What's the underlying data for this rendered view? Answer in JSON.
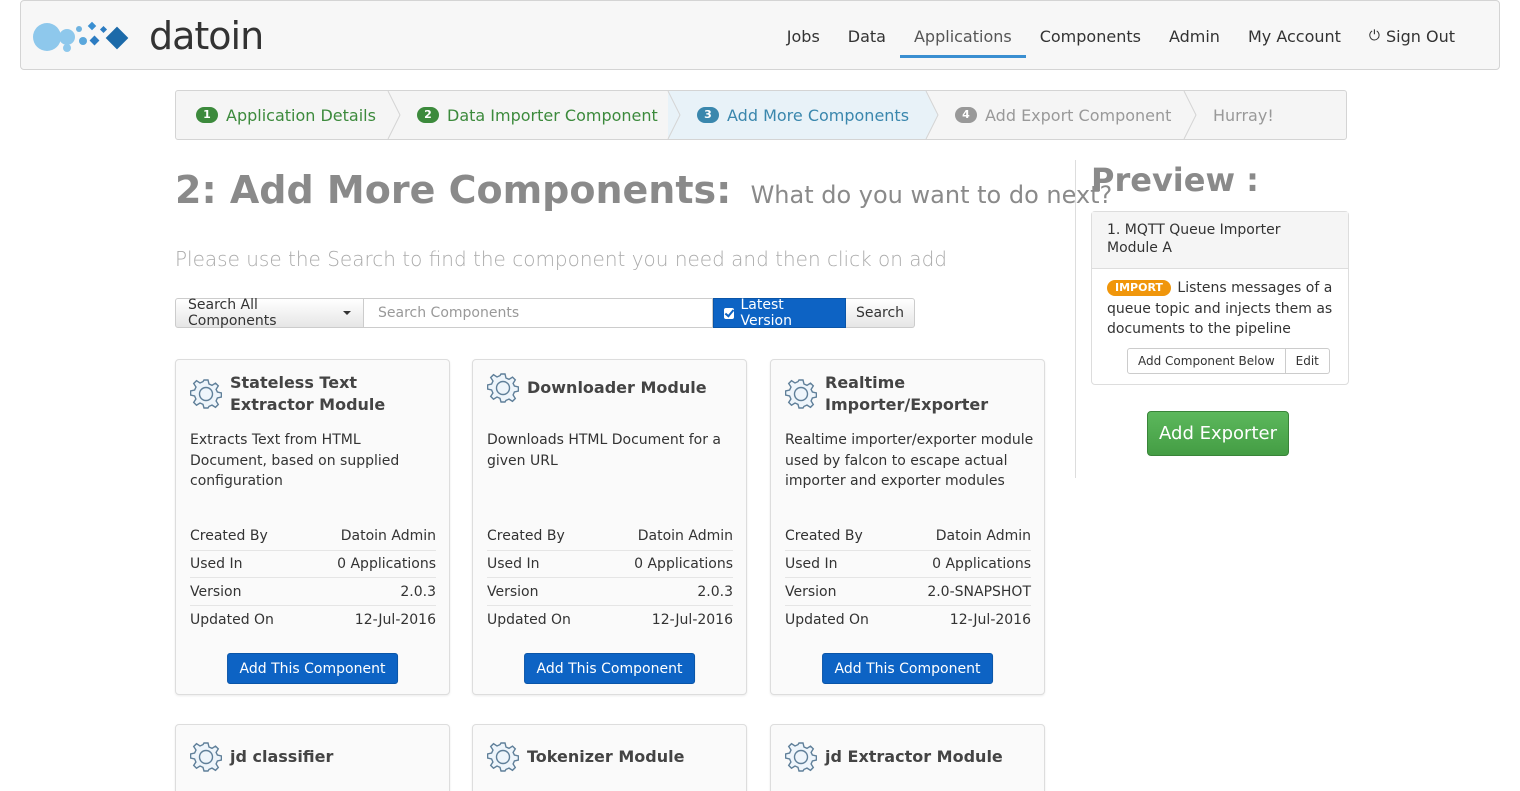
{
  "brand": {
    "name": "datoin"
  },
  "nav": {
    "items": [
      {
        "label": "Jobs"
      },
      {
        "label": "Data"
      },
      {
        "label": "Applications",
        "active": true
      },
      {
        "label": "Components"
      },
      {
        "label": "Admin"
      },
      {
        "label": "My Account"
      },
      {
        "label": "Sign Out",
        "icon": "power-icon"
      }
    ]
  },
  "wizard": {
    "steps": [
      {
        "num": "1",
        "label": "Application Details",
        "state": "done"
      },
      {
        "num": "2",
        "label": "Data Importer Component",
        "state": "done"
      },
      {
        "num": "3",
        "label": "Add More Components",
        "state": "active"
      },
      {
        "num": "4",
        "label": "Add Export Component",
        "state": "todo"
      },
      {
        "num": "",
        "label": "Hurray!",
        "state": "todo"
      }
    ]
  },
  "page": {
    "title": "2: Add More Components:",
    "subtitle": "What do you want to do next?",
    "instructions": "Please use the Search to find the component you need and then click on add"
  },
  "search": {
    "scope_label": "Search All Components",
    "placeholder": "Search Components",
    "latest_label": "Latest Version",
    "latest_checked": true,
    "button_label": "Search"
  },
  "table_labels": {
    "created_by": "Created By",
    "used_in": "Used In",
    "version": "Version",
    "updated_on": "Updated On"
  },
  "components": [
    {
      "name": "Stateless Text Extractor Module",
      "description": "Extracts Text from HTML Document, based on supplied configuration",
      "created_by": "Datoin Admin",
      "used_in": "0 Applications",
      "version": "2.0.3",
      "updated_on": "12-Jul-2016",
      "button": "Add This Component"
    },
    {
      "name": "Downloader Module",
      "description": "Downloads HTML Document for a given URL",
      "created_by": "Datoin Admin",
      "used_in": "0 Applications",
      "version": "2.0.3",
      "updated_on": "12-Jul-2016",
      "button": "Add This Component"
    },
    {
      "name": "Realtime Importer/Exporter",
      "description": "Realtime importer/exporter module used by falcon to escape actual importer and exporter modules",
      "created_by": "Datoin Admin",
      "used_in": "0 Applications",
      "version": "2.0-SNAPSHOT",
      "updated_on": "12-Jul-2016",
      "button": "Add This Component"
    },
    {
      "name": "jd classifier"
    },
    {
      "name": "Tokenizer Module"
    },
    {
      "name": "jd Extractor Module"
    }
  ],
  "preview": {
    "title": "Preview :",
    "item_title": "1. MQTT Queue Importer Module A",
    "badge": "IMPORT",
    "description": "Listens messages of a queue topic and injects them as documents to the pipeline",
    "add_below_label": "Add Component Below",
    "edit_label": "Edit"
  },
  "add_exporter_label": "Add Exporter",
  "colors": {
    "primary": "#0d63c4",
    "success": "#5cb85c",
    "import_badge": "#f0960b",
    "step_done": "#3c8a3c",
    "step_active": "#3a87ad",
    "nav_active_underline": "#3a8fd1"
  }
}
